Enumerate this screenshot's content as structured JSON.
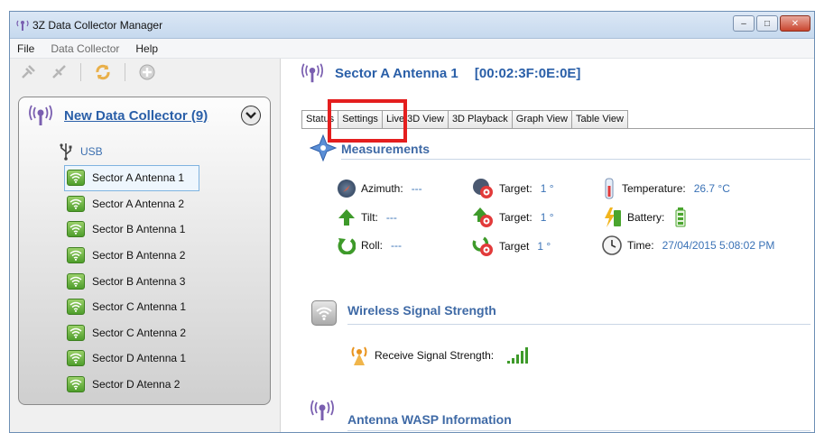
{
  "window": {
    "title": "3Z Data Collector Manager"
  },
  "menu": {
    "file": "File",
    "data_collector": "Data Collector",
    "help": "Help"
  },
  "collector": {
    "title": "New Data Collector (9)",
    "usb_label": "USB",
    "devices": [
      "Sector A Antenna 1",
      "Sector A Antenna 2",
      "Sector B Antenna 1",
      "Sector B Antenna 2",
      "Sector B Antenna 3",
      "Sector C Antenna 1",
      "Sector C Antenna 2",
      "Sector D Antenna 1",
      "Sector D Atenna 2"
    ],
    "selected_index": 0
  },
  "device": {
    "name": "Sector A Antenna 1",
    "address": "[00:02:3F:0E:0E]"
  },
  "tabs": [
    "Status",
    "Settings",
    "Live 3D View",
    "3D Playback",
    "Graph View",
    "Table View"
  ],
  "measurements": {
    "title": "Measurements",
    "azimuth_label": "Azimuth:",
    "azimuth_value": "---",
    "target1_label": "Target:",
    "target1_value": "1 °",
    "temperature_label": "Temperature:",
    "temperature_value": "26.7 °C",
    "tilt_label": "Tilt:",
    "tilt_value": "---",
    "target2_label": "Target:",
    "target2_value": "1 °",
    "battery_label": "Battery:",
    "roll_label": "Roll:",
    "roll_value": "---",
    "target3_label": "Target",
    "target3_value": "1 °",
    "time_label": "Time:",
    "time_value": "27/04/2015 5:08:02 PM"
  },
  "wireless": {
    "title": "Wireless Signal Strength",
    "receive_label": "Receive Signal Strength:"
  },
  "wasp": {
    "title": "Antenna WASP Information"
  },
  "colors": {
    "accent": "#2a5fa8",
    "value": "#3a72b6",
    "highlight": "#e41e1e",
    "wifi_green": "#4f9e2c"
  }
}
